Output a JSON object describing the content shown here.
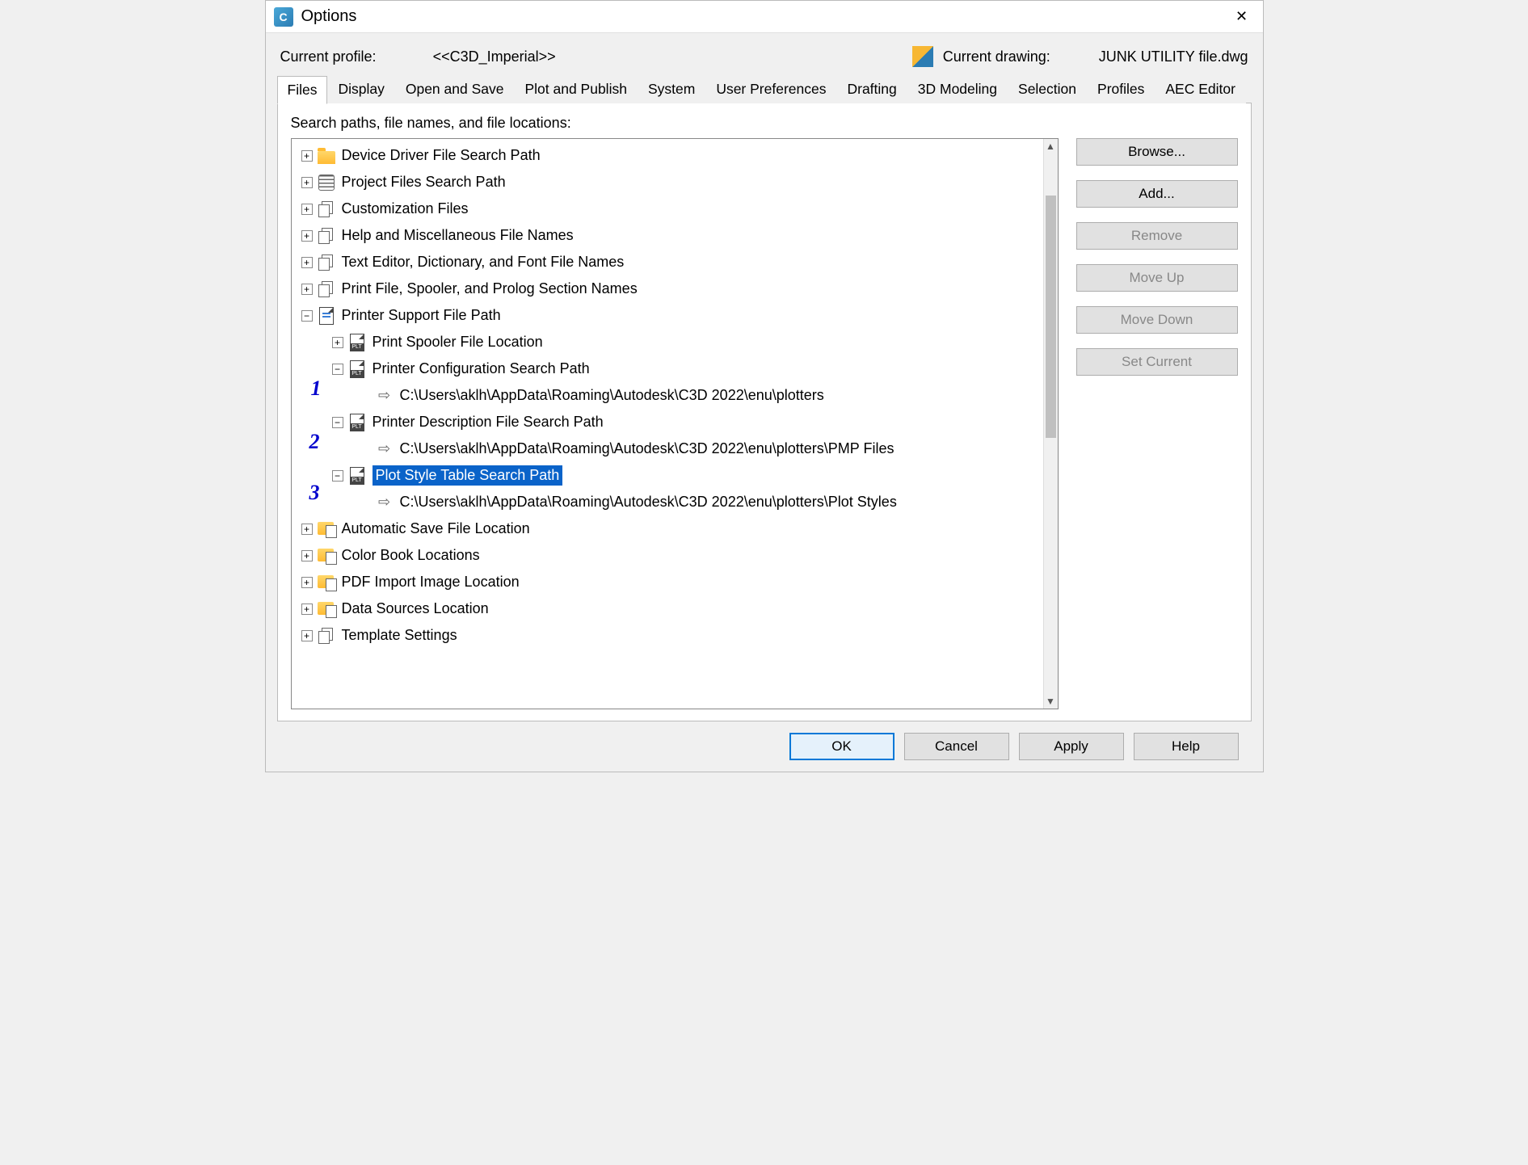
{
  "window": {
    "title": "Options",
    "close": "✕"
  },
  "profile": {
    "label": "Current profile:",
    "value": "<<C3D_Imperial>>",
    "drawing_label": "Current drawing:",
    "drawing_value": "JUNK UTILITY file.dwg"
  },
  "tabs": {
    "files": "Files",
    "display": "Display",
    "open_save": "Open and Save",
    "plot_publish": "Plot and Publish",
    "system": "System",
    "user_prefs": "User Preferences",
    "drafting": "Drafting",
    "modeling": "3D Modeling",
    "selection": "Selection",
    "profiles": "Profiles",
    "aec": "AEC Editor"
  },
  "section_label": "Search paths, file names, and file locations:",
  "tree": {
    "device_driver": "Device Driver File Search Path",
    "project_files": "Project Files Search Path",
    "customization": "Customization Files",
    "help_misc": "Help and Miscellaneous File Names",
    "text_editor": "Text Editor, Dictionary, and Font File Names",
    "print_spooler_prolog": "Print File, Spooler, and Prolog Section Names",
    "printer_support": "Printer Support File Path",
    "print_spooler_loc": "Print Spooler File Location",
    "printer_config": "Printer Configuration Search Path",
    "printer_config_path": "C:\\Users\\aklh\\AppData\\Roaming\\Autodesk\\C3D 2022\\enu\\plotters",
    "printer_desc": "Printer Description File Search Path",
    "printer_desc_path": "C:\\Users\\aklh\\AppData\\Roaming\\Autodesk\\C3D 2022\\enu\\plotters\\PMP Files",
    "plot_style": "Plot Style Table Search Path",
    "plot_style_path": "C:\\Users\\aklh\\AppData\\Roaming\\Autodesk\\C3D 2022\\enu\\plotters\\Plot Styles",
    "auto_save": "Automatic Save File Location",
    "color_book": "Color Book Locations",
    "pdf_import": "PDF Import Image Location",
    "data_sources": "Data Sources Location",
    "template": "Template Settings"
  },
  "side_buttons": {
    "browse": "Browse...",
    "add": "Add...",
    "remove": "Remove",
    "move_up": "Move Up",
    "move_down": "Move Down",
    "set_current": "Set Current"
  },
  "bottom_buttons": {
    "ok": "OK",
    "cancel": "Cancel",
    "apply": "Apply",
    "help": "Help"
  },
  "annotations": {
    "a1": "1",
    "a2": "2",
    "a3": "3"
  }
}
